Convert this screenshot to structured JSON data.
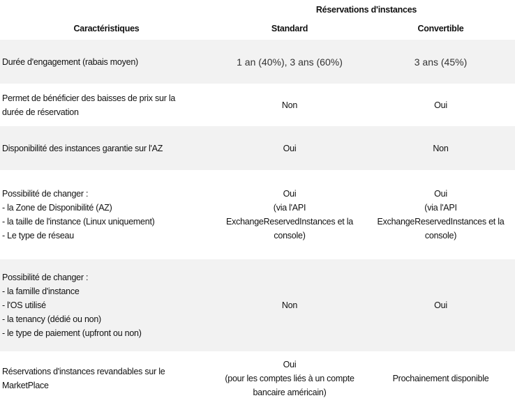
{
  "table": {
    "group_header": "Réservations d'instances",
    "columns": [
      "Caractéristiques",
      "Standard",
      "Convertible"
    ],
    "rows": [
      {
        "feature_lines": [
          "Durée d'engagement (rabais moyen)"
        ],
        "standard_lines": [
          "1 an (40%), 3 ans (60%)"
        ],
        "convertible_lines": [
          "3 ans (45%)"
        ],
        "shaded": true
      },
      {
        "feature_lines": [
          "Permet de bénéficier des baisses de prix sur la",
          "durée de réservation"
        ],
        "standard_lines": [
          "Non"
        ],
        "convertible_lines": [
          "Oui"
        ],
        "shaded": false
      },
      {
        "feature_lines": [
          "Disponibilité des instances garantie sur l'AZ"
        ],
        "standard_lines": [
          "Oui"
        ],
        "convertible_lines": [
          "Non"
        ],
        "shaded": true
      },
      {
        "feature_lines": [
          "Possibilité de changer :",
          "- la Zone de Disponibilité (AZ)",
          "- la taille de l'instance (Linux uniquement)",
          "- Le type de réseau"
        ],
        "standard_lines": [
          "Oui",
          "(via l'API",
          "ExchangeReservedInstances  et la",
          "console)"
        ],
        "convertible_lines": [
          "Oui",
          "(via l'API",
          "ExchangeReservedInstances  et la",
          "console)"
        ],
        "shaded": false
      },
      {
        "feature_lines": [
          "Possibilité de changer :",
          "- la famille d'instance",
          "- l'OS utilisé",
          "- la tenancy (dédié ou non)",
          "- le type de paiement (upfront ou non)"
        ],
        "standard_lines": [
          "Non"
        ],
        "convertible_lines": [
          "Oui"
        ],
        "shaded": true
      },
      {
        "feature_lines": [
          "Réservations d'instances revandables sur le",
          "MarketPlace"
        ],
        "standard_lines": [
          "Oui",
          "(pour les comptes liés à un compte",
          "bancaire américain)"
        ],
        "convertible_lines": [
          "Prochainement disponible"
        ],
        "shaded": false
      }
    ]
  }
}
